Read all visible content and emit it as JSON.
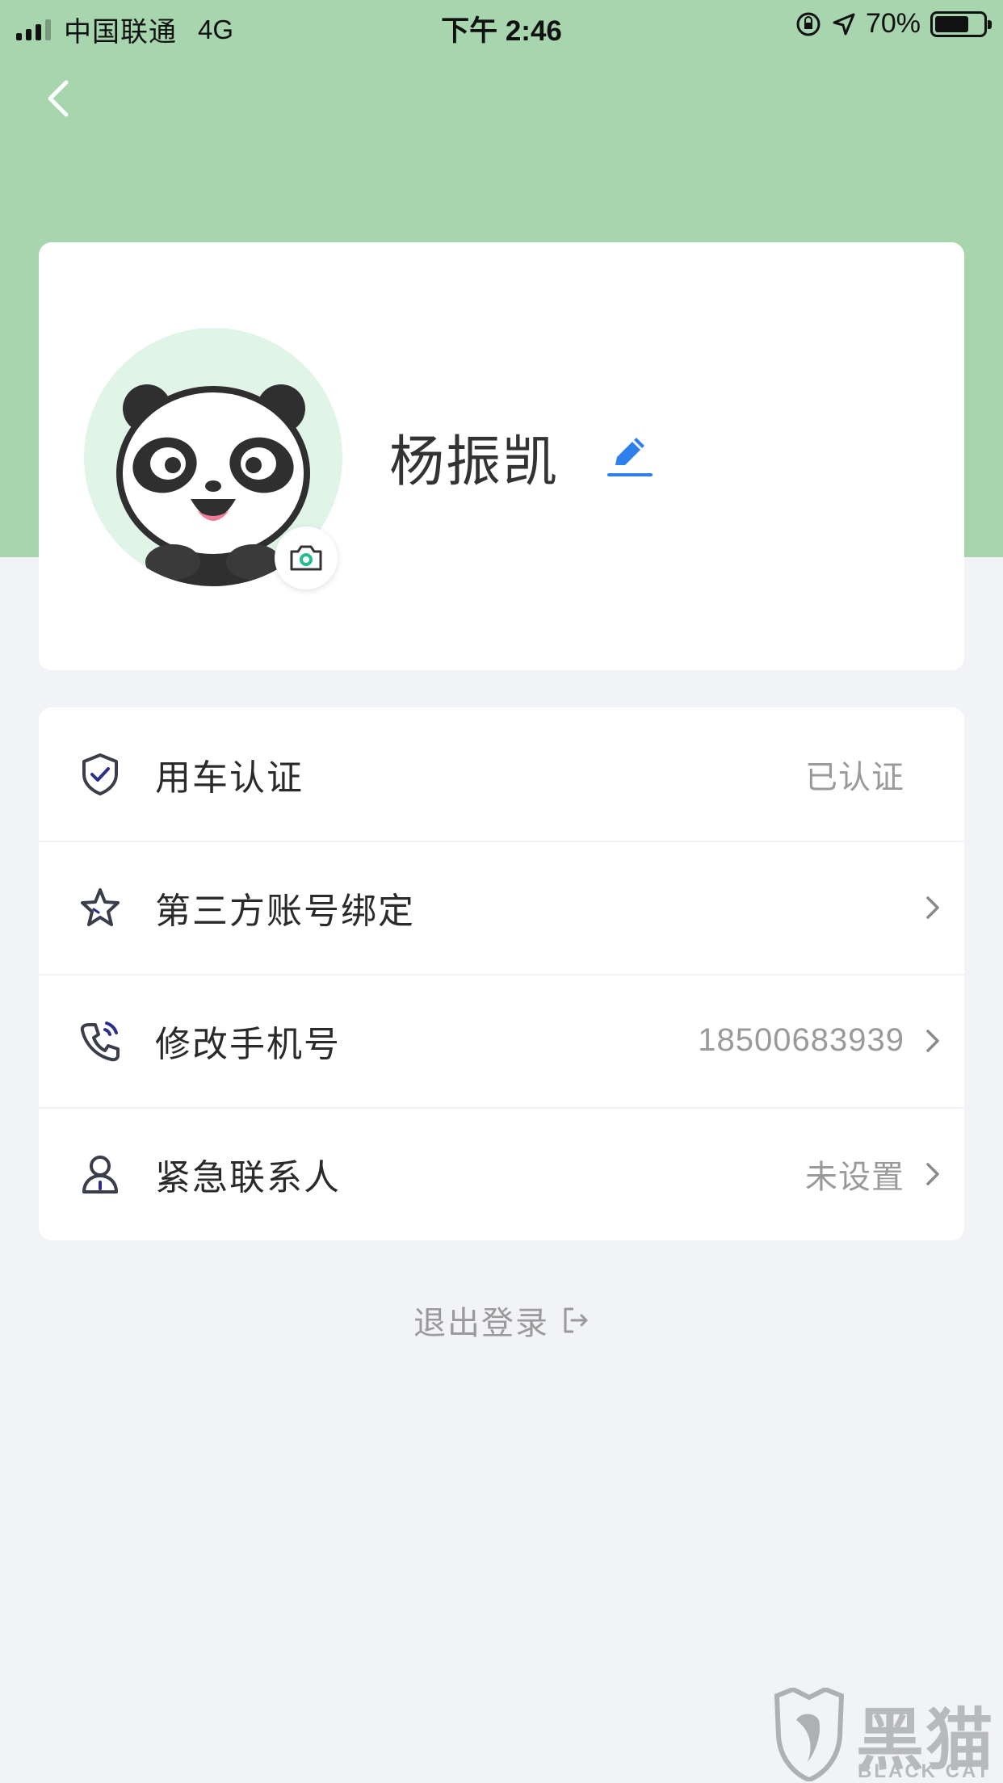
{
  "status_bar": {
    "carrier": "中国联通",
    "network": "4G",
    "time": "下午 2:46",
    "battery": "70%",
    "battery_level": 0.7
  },
  "profile": {
    "name": "杨振凯",
    "avatar": "panda-avatar",
    "camera_icon": "camera-icon",
    "edit_icon": "pencil-edit-icon"
  },
  "menu": {
    "items": [
      {
        "label": "用车认证",
        "value": "已认证",
        "icon": "shield-check-icon",
        "chevron": false
      },
      {
        "label": "第三方账号绑定",
        "value": "",
        "icon": "star-icon",
        "chevron": true
      },
      {
        "label": "修改手机号",
        "value": "18500683939",
        "icon": "phone-icon",
        "chevron": true
      },
      {
        "label": "紧急联系人",
        "value": "未设置",
        "icon": "person-icon",
        "chevron": true
      }
    ]
  },
  "logout": {
    "label": "退出登录",
    "icon": "logout-icon"
  },
  "watermark": {
    "title": "黑猫",
    "subtitle": "BLACK CAT"
  },
  "colors": {
    "header_green": "#a6d5ae",
    "accent_blue": "#2f80ed",
    "camera_teal": "#1fbf8f"
  }
}
